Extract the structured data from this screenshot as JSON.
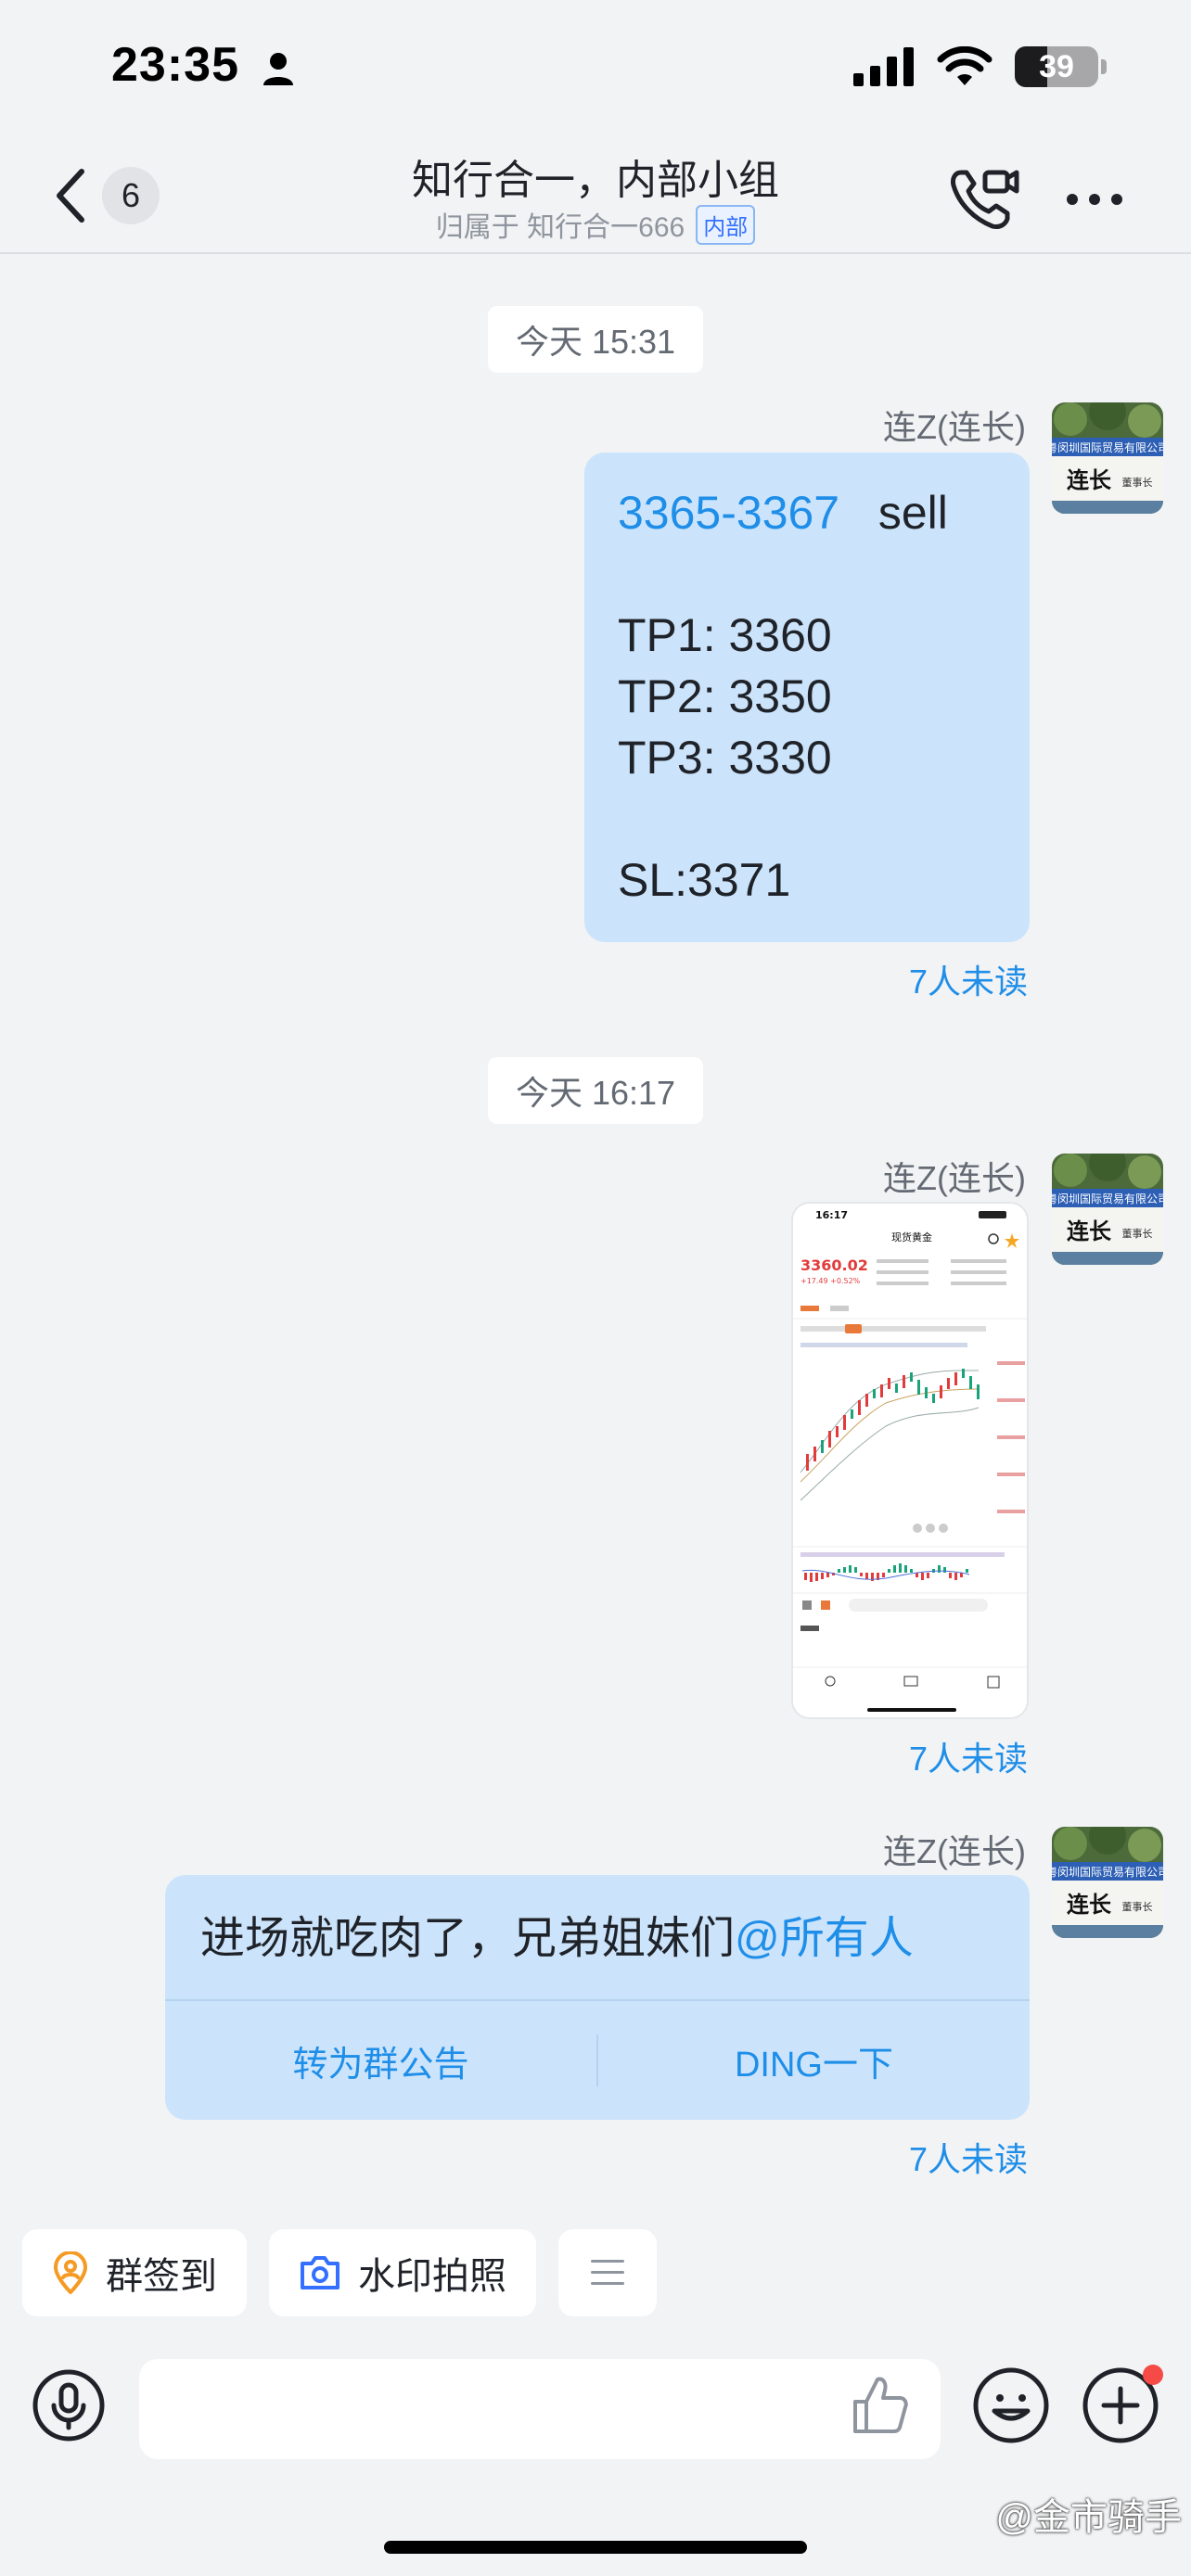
{
  "status_bar": {
    "time": "23:35",
    "battery": "39",
    "battery_level": 0.39
  },
  "nav": {
    "back_count": "6",
    "title": "知行合一，内部小组",
    "subtitle": "归属于 知行合一666",
    "badge": "内部"
  },
  "messages": [
    {
      "time": "今天 15:31",
      "sender": "连Z(连长)",
      "range": "3365-3367",
      "action": "sell",
      "tp1": "TP1: 3360",
      "tp2": "TP2: 3350",
      "tp3": "TP3: 3330",
      "sl": "SL:3371",
      "unread": "7人未读"
    },
    {
      "time": "今天 16:17",
      "sender": "连Z(连长)",
      "type": "image",
      "image_title": "现货黄金",
      "image_time": "16:17",
      "image_price": "3360.02",
      "image_change": "+17.49 +0.52%",
      "unread": "7人未读"
    },
    {
      "sender": "连Z(连长)",
      "text": "进场就吃肉了，兄弟姐妹们",
      "mention": "@所有人",
      "action_left": "转为群公告",
      "action_right": "DING一下",
      "unread": "7人未读"
    }
  ],
  "avatar": {
    "company": "粤闵圳国际贸易有限公司",
    "name": "连长",
    "title": "董事长"
  },
  "quick_actions": {
    "checkin": "群签到",
    "watermark_photo": "水印拍照"
  },
  "input": {
    "value": "",
    "placeholder": ""
  },
  "watermark": "@金市骑手",
  "colors": {
    "accent": "#1f8ee8",
    "bubble": "#cce4fb",
    "background": "#f2f3f5"
  }
}
